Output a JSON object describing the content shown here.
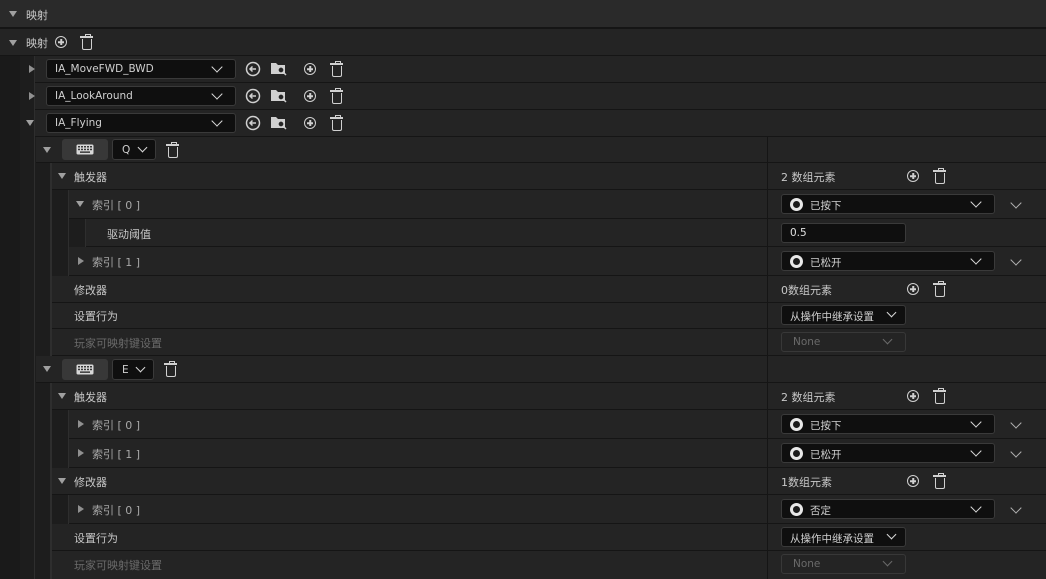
{
  "section": {
    "title": "映射"
  },
  "mappings_header": {
    "label": "映射"
  },
  "actions": [
    {
      "name": "IA_MoveFWD_BWD"
    },
    {
      "name": "IA_LookAround"
    },
    {
      "name": "IA_Flying"
    }
  ],
  "keys": [
    {
      "key": "Q",
      "triggers": {
        "label": "触发器",
        "count": "2 数组元素",
        "items": [
          {
            "label": "索引 [ 0 ]",
            "value": "已按下",
            "expanded": true,
            "sub": {
              "label": "驱动阈值",
              "value": "0.5"
            }
          },
          {
            "label": "索引 [ 1 ]",
            "value": "已松开"
          }
        ]
      },
      "modifiers": {
        "label": "修改器",
        "count": "0数组元素",
        "items": []
      },
      "setting_behavior": {
        "label": "设置行为",
        "value": "从操作中继承设置"
      },
      "player_mappable": {
        "label": "玩家可映射键设置",
        "value": "None"
      }
    },
    {
      "key": "E",
      "triggers": {
        "label": "触发器",
        "count": "2 数组元素",
        "items": [
          {
            "label": "索引 [ 0 ]",
            "value": "已按下"
          },
          {
            "label": "索引 [ 1 ]",
            "value": "已松开"
          }
        ]
      },
      "modifiers": {
        "label": "修改器",
        "count": "1数组元素",
        "items": [
          {
            "label": "索引 [ 0 ]",
            "value": "否定"
          }
        ]
      },
      "setting_behavior": {
        "label": "设置行为",
        "value": "从操作中继承设置"
      },
      "player_mappable": {
        "label": "玩家可映射键设置",
        "value": "None"
      }
    }
  ],
  "colors": {
    "bg": "#151515",
    "row": "#242424",
    "row_alt": "#1f1f1f",
    "field": "#0f0f0f",
    "text": "#c8c8c8",
    "disabled": "#6a6a6a"
  }
}
